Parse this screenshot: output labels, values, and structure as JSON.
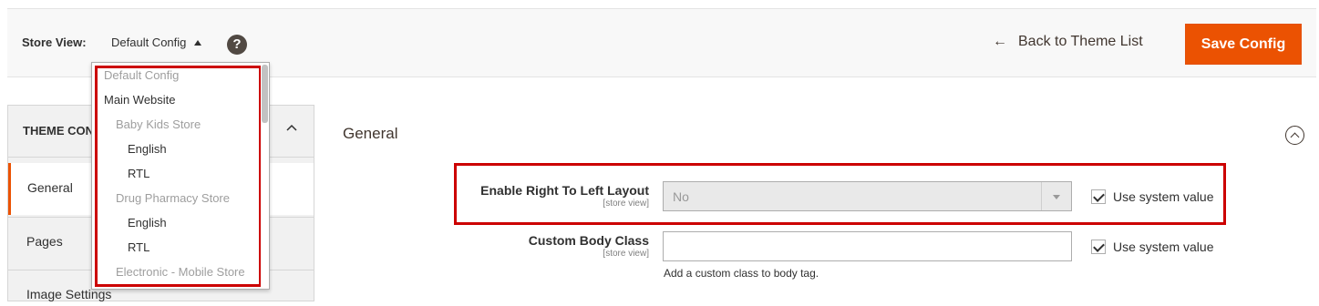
{
  "toolbar": {
    "store_view_label": "Store View:",
    "store_view_current": "Default Config",
    "help_symbol": "?",
    "back_arrow": "←",
    "back_label": "Back to Theme List",
    "save_label": "Save Config",
    "accent_color": "#eb5202"
  },
  "store_dropdown": {
    "options": [
      {
        "label": "Default Config",
        "state": "disabled"
      },
      {
        "label": "Main Website",
        "state": "enabled"
      },
      {
        "label": "Baby Kids Store",
        "state": "disabled"
      },
      {
        "label": "English",
        "state": "enabled"
      },
      {
        "label": "RTL",
        "state": "enabled"
      },
      {
        "label": "Drug Pharmacy Store",
        "state": "disabled"
      },
      {
        "label": "English",
        "state": "enabled"
      },
      {
        "label": "RTL",
        "state": "enabled"
      },
      {
        "label": "Electronic - Mobile Store",
        "state": "disabled"
      }
    ]
  },
  "sidebar": {
    "title": "THEME CONFIGURATION",
    "items": [
      {
        "label": "General",
        "active": true
      },
      {
        "label": "Pages",
        "active": false
      },
      {
        "label": "Image Settings",
        "active": false
      }
    ]
  },
  "main": {
    "section_title": "General",
    "fields": [
      {
        "label": "Enable Right To Left Layout",
        "scope": "[store view]",
        "value": "No",
        "use_system_value": true,
        "use_system_label": "Use system value"
      },
      {
        "label": "Custom Body Class",
        "scope": "[store view]",
        "value": "",
        "use_system_value": true,
        "use_system_label": "Use system value",
        "note": "Add a custom class to body tag."
      }
    ]
  }
}
